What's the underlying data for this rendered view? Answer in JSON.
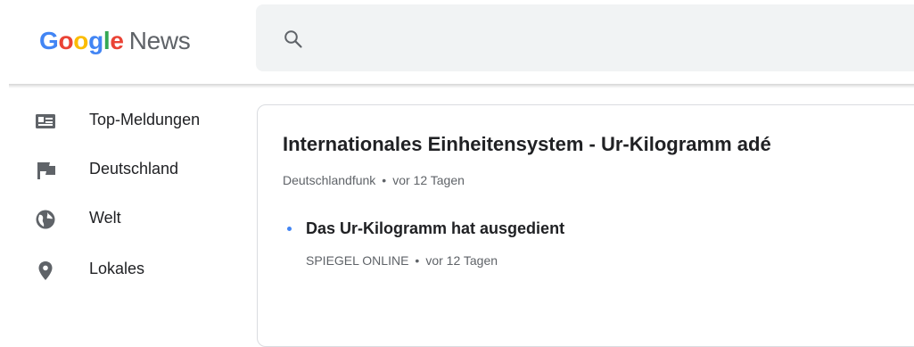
{
  "header": {
    "logo": {
      "letters": [
        "G",
        "o",
        "o",
        "g",
        "l",
        "e"
      ],
      "letter_colors": [
        "#4285F4",
        "#EA4335",
        "#FBBC05",
        "#4285F4",
        "#34A853",
        "#EA4335"
      ],
      "suffix": "News"
    },
    "search": {
      "icon": "search-icon",
      "background": "#f1f3f4"
    }
  },
  "sidebar": {
    "items": [
      {
        "label": "Top-Meldungen",
        "icon": "newspaper-icon"
      },
      {
        "label": "Deutschland",
        "icon": "flag-icon"
      },
      {
        "label": "Welt",
        "icon": "globe-icon"
      },
      {
        "label": "Lokales",
        "icon": "location-pin-icon"
      }
    ],
    "icon_color": "#5f6368"
  },
  "story": {
    "headline": "Internationales Einheitensystem  - Ur-Kilogramm adé",
    "source": "Deutschlandfunk",
    "separator": "•",
    "time": "vor 12 Tagen",
    "related": {
      "headline": "Das Ur-Kilogramm hat ausgedient",
      "source": "SPIEGEL ONLINE",
      "time": "vor 12 Tagen",
      "bullet_color": "#4285F4"
    }
  }
}
